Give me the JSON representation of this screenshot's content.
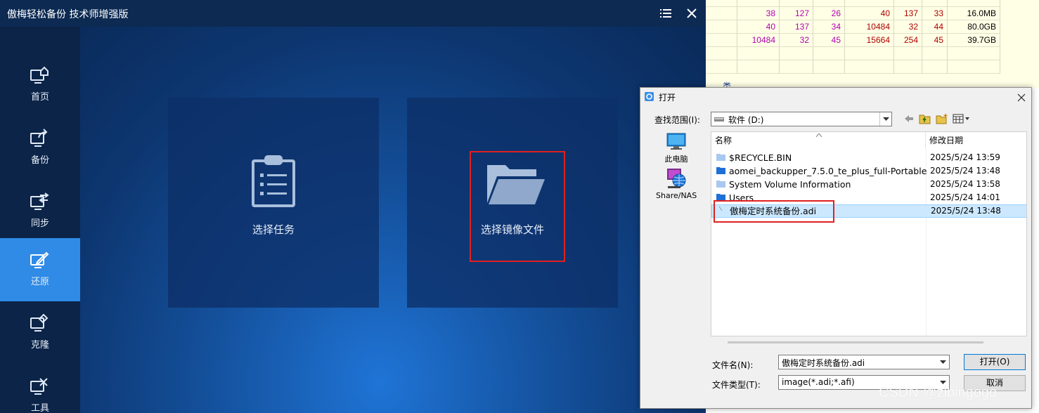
{
  "app": {
    "title": "傲梅轻松备份 技术师增强版",
    "menu_icon": "menu-icon",
    "close_icon": "close-icon"
  },
  "sidebar": {
    "items": [
      {
        "label": "首页",
        "icon": "home-icon"
      },
      {
        "label": "备份",
        "icon": "backup-icon"
      },
      {
        "label": "同步",
        "icon": "sync-icon"
      },
      {
        "label": "还原",
        "icon": "restore-icon",
        "active": true
      },
      {
        "label": "克隆",
        "icon": "clone-icon"
      },
      {
        "label": "工具",
        "icon": "tools-icon"
      }
    ]
  },
  "main": {
    "cards": [
      {
        "label": "选择任务",
        "icon": "clipboard-list-icon"
      },
      {
        "label": "选择镜像文件",
        "icon": "folder-open-icon"
      }
    ]
  },
  "sheet": {
    "rows": [
      [
        "38",
        "127",
        "26",
        "40",
        "137",
        "33",
        "16.0MB"
      ],
      [
        "40",
        "137",
        "34",
        "10484",
        "32",
        "44",
        "80.0GB"
      ],
      [
        "10484",
        "32",
        "45",
        "15664",
        "254",
        "45",
        "39.7GB"
      ]
    ],
    "below_text": "类"
  },
  "dialog": {
    "title": "打开",
    "look_in_label": "查找范围(I):",
    "look_in_value": "软件 (D:)",
    "places": [
      {
        "label": "此电脑",
        "icon": "computer-icon"
      },
      {
        "label": "Share/NAS",
        "icon": "network-globe-icon"
      }
    ],
    "columns": {
      "name": "名称",
      "date": "修改日期"
    },
    "files": [
      {
        "name": "$RECYCLE.BIN",
        "date": "2025/5/24 13:59",
        "type": "folder-light"
      },
      {
        "name": "aomei_backupper_7.5.0_te_plus_full-Portable",
        "date": "2025/5/24 13:48",
        "type": "folder"
      },
      {
        "name": "System Volume Information",
        "date": "2025/5/24 13:58",
        "type": "folder-light"
      },
      {
        "name": "Users",
        "date": "2025/5/24 14:01",
        "type": "folder"
      },
      {
        "name": "傲梅定时系统备份.adi",
        "date": "2025/5/24 13:48",
        "type": "file",
        "selected": true
      }
    ],
    "filename_label": "文件名(N):",
    "filename_value": "傲梅定时系统备份.adi",
    "filetype_label": "文件类型(T):",
    "filetype_value": "image(*.adi;*.afi)",
    "open_button": "打开(O)",
    "cancel_button": "取消"
  },
  "watermark": "CSDN @zibingogo",
  "colors": {
    "sidebar_active": "#2f8be6",
    "highlight_box": "#e02020",
    "selection": "#cce8ff"
  }
}
